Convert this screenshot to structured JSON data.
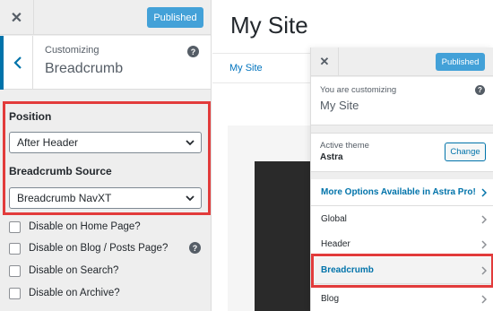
{
  "left_panel": {
    "close_icon": "close-icon",
    "published_label": "Published",
    "customizing_label": "Customizing",
    "section_title": "Breadcrumb",
    "back_icon": "chevron-left-icon",
    "help_icon": "help-icon",
    "position_label": "Position",
    "position_value": "After Header",
    "source_label": "Breadcrumb Source",
    "source_value": "Breadcrumb NavXT",
    "checkboxes": [
      {
        "label": "Disable on Home Page?",
        "checked": false
      },
      {
        "label": "Disable on Blog / Posts Page?",
        "checked": false
      },
      {
        "label": "Disable on Search?",
        "checked": false
      },
      {
        "label": "Disable on Archive?",
        "checked": false
      }
    ]
  },
  "preview": {
    "site_title": "My Site",
    "nav_link": "My Site"
  },
  "overlay": {
    "close_icon": "close-icon",
    "published_label": "Published",
    "customizing_label": "You are customizing",
    "site_name": "My Site",
    "active_theme_label": "Active theme",
    "theme_name": "Astra",
    "change_label": "Change",
    "items": [
      {
        "label": "More Options Available in Astra Pro!"
      },
      {
        "label": "Global"
      },
      {
        "label": "Header"
      },
      {
        "label": "Breadcrumb"
      },
      {
        "label": "Blog"
      }
    ]
  },
  "colors": {
    "accent": "#0073aa",
    "published_bg": "#43a1d8",
    "highlight_red": "#e23b3b",
    "panel_bg": "#eeeeee"
  }
}
